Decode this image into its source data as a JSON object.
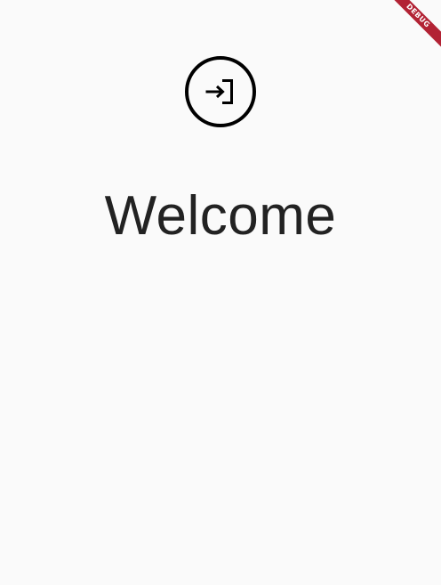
{
  "app": {
    "login_icon": "login-icon",
    "title": "Welcome",
    "debug_banner": "DEBUG"
  },
  "colors": {
    "background": "#fafafa",
    "icon": "#000000",
    "title": "#222222",
    "debug_banner": "#b22234"
  }
}
